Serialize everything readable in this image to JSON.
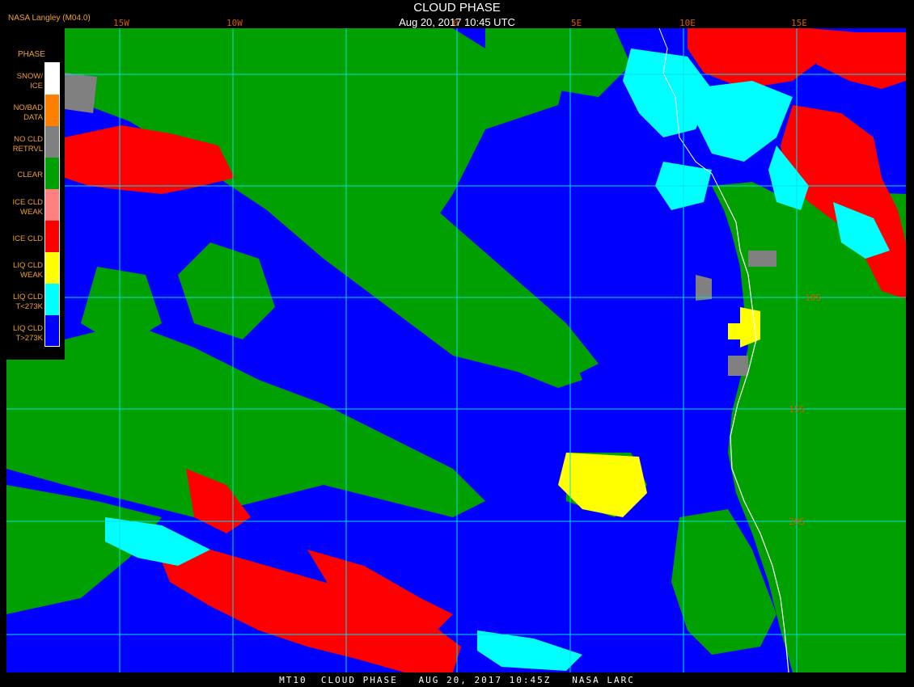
{
  "header": {
    "title": "CLOUD PHASE",
    "subtitle": "Aug 20, 2017 10:45 UTC",
    "credit": "NASA Langley (M04.0)"
  },
  "footer": {
    "text": "MT10  CLOUD PHASE   AUG 20, 2017 10:45Z   NASA LARC"
  },
  "legend": {
    "title": "PHASE",
    "items": [
      {
        "label": "SNOW/\nICE",
        "color": "#ffffff"
      },
      {
        "label": "NO/BAD\nDATA",
        "color": "#ff8000"
      },
      {
        "label": "NO CLD\nRETRVL",
        "color": "#808080"
      },
      {
        "label": "CLEAR",
        "color": "#00a000"
      },
      {
        "label": "ICE CLD\nWEAK",
        "color": "#ff8080"
      },
      {
        "label": "ICE CLD",
        "color": "#ff0000"
      },
      {
        "label": "LIQ CLD\nWEAK",
        "color": "#ffff00"
      },
      {
        "label": "LIQ CLD\nT<273K",
        "color": "#00ffff"
      },
      {
        "label": "LIQ CLD\nT>273K",
        "color": "#0000ff"
      }
    ]
  },
  "grid": {
    "color": "#00e0e0",
    "lon_labels": [
      "15W",
      "10W",
      "0",
      "5E",
      "10E",
      "15E"
    ],
    "lat_labels": [
      "10S",
      "15S",
      "20S"
    ]
  },
  "colors": {
    "ocean_liquid": "#0000ff",
    "clear": "#00a000",
    "ice": "#ff0000",
    "liquid_cold": "#00ffff",
    "liquid_weak": "#ffff00",
    "no_retrieval": "#808080",
    "coastline": "#ffffff"
  }
}
